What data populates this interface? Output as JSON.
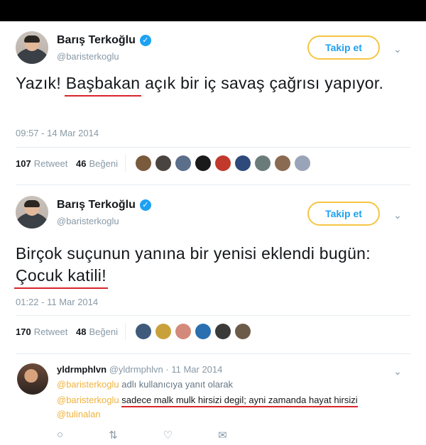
{
  "tweets": [
    {
      "author": "Barış Terkoğlu",
      "handle": "@baristerkoglu",
      "follow_label": "Takip et",
      "text_before": "Yazık! ",
      "text_underlined": "Başbakan",
      "text_after": " açık bir iç savaş çağrısı yapıyor.",
      "time": "09:57 - 14 Mar 2014",
      "retweet_count": "107",
      "retweet_label": "Retweet",
      "like_count": "46",
      "like_label": "Beğeni"
    },
    {
      "author": "Barış Terkoğlu",
      "handle": "@baristerkoglu",
      "follow_label": "Takip et",
      "text_before": "Birçok suçunun yanına bir yenisi eklendi bugün: ",
      "text_underlined": "Çocuk katili!",
      "text_after": "",
      "time": "01:22 - 11 Mar 2014",
      "retweet_count": "170",
      "retweet_label": "Retweet",
      "like_count": "48",
      "like_label": "Beğeni"
    }
  ],
  "reply": {
    "author": "yldrmphlvn",
    "handle": "@yldrmphlvn",
    "date": "· 11 Mar 2014",
    "reply_to_mention": "@baristerkoglu",
    "reply_to_text": " adlı kullanıcıya yanıt olarak",
    "body_mention": "@baristerkoglu",
    "body_text": "sadece malk mulk hirsizi degil;  ayni zamanda  hayat hirsizi",
    "extra_mention": "@tulinalan"
  },
  "colors": {
    "accent": "#1da1f2",
    "highlight": "#f0b23b",
    "underline": "#d9252b"
  },
  "icons": [
    "verified-icon",
    "chevron-down-icon",
    "reply-icon",
    "retweet-icon",
    "like-icon",
    "message-icon"
  ]
}
